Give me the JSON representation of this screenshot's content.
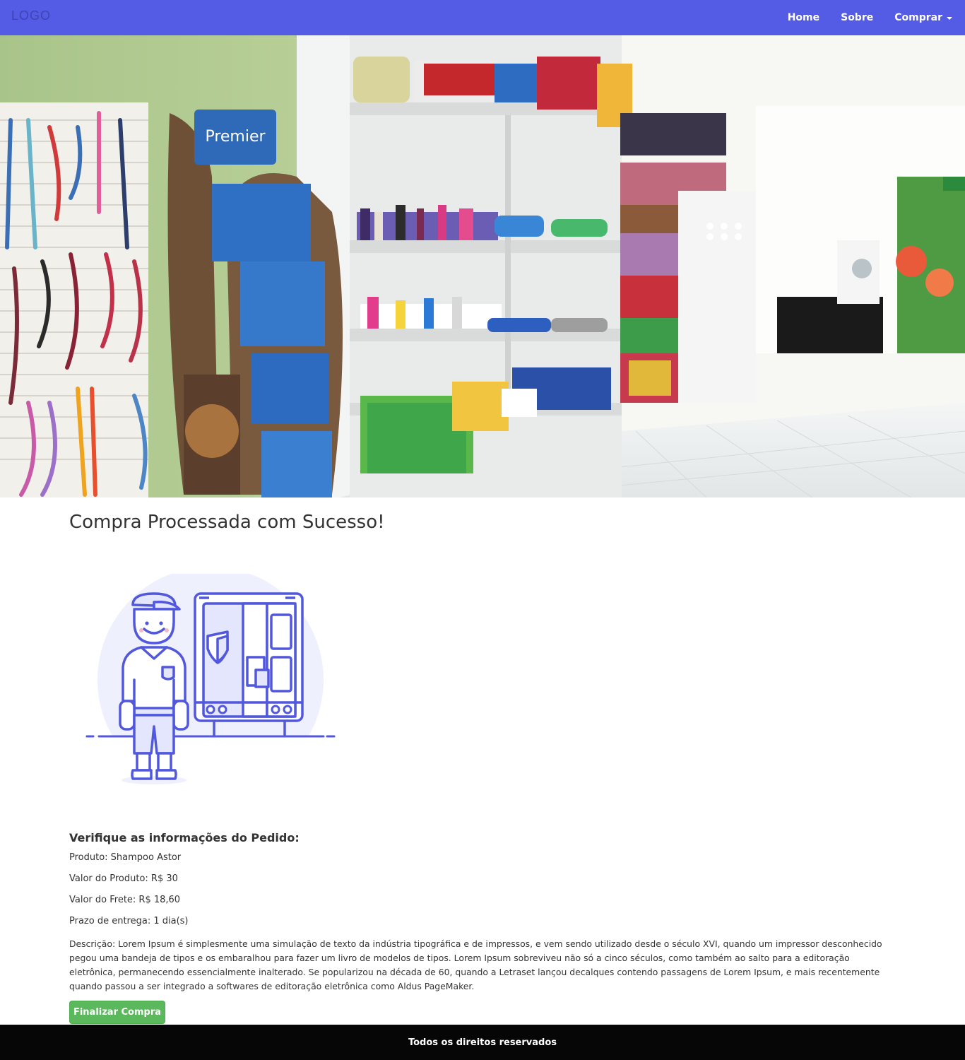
{
  "navbar": {
    "logo": "LOGO",
    "links": {
      "home": "Home",
      "about": "Sobre",
      "buy": "Comprar"
    }
  },
  "hero": {
    "image": "pet-shop-interior-photo"
  },
  "main": {
    "title": "Compra Processada com Sucesso!",
    "illustration": "delivery-person-and-truck",
    "section_title": "Verifique as informações do Pedido:",
    "product": "Produto: Shampoo Astor",
    "product_value": "Valor do Produto: R$ 30",
    "shipping_value": "Valor do Frete: R$ 18,60",
    "delivery_time": "Prazo de entrega: 1 dia(s)",
    "description": "Descrição: Lorem Ipsum é simplesmente uma simulação de texto da indústria tipográfica e de impressos, e vem sendo utilizado desde o século XVI, quando um impressor desconhecido pegou uma bandeja de tipos e os embaralhou para fazer um livro de modelos de tipos. Lorem Ipsum sobreviveu não só a cinco séculos, como também ao salto para a editoração eletrônica, permanecendo essencialmente inalterado. Se popularizou na década de 60, quando a Letraset lançou decalques contendo passagens de Lorem Ipsum, e mais recentemente quando passou a ser integrado a softwares de editoração eletrônica como Aldus PageMaker.",
    "finish_button": "Finalizar Compra"
  },
  "footer": {
    "text": "Todos os direitos reservados"
  },
  "colors": {
    "navbar": "#545ce6",
    "button": "#5cb85c",
    "footer": "#060606",
    "illustration": "#5158dc"
  }
}
